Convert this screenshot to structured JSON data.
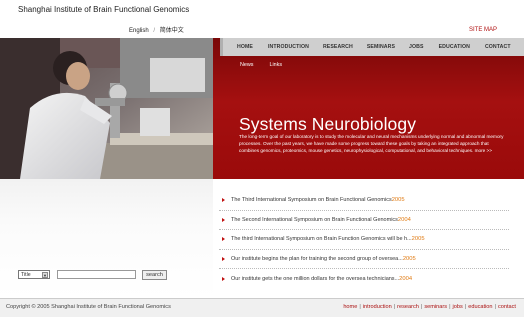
{
  "header": {
    "site_title": "Shanghai Institute of Brain Functional Genomics",
    "lang_en": "English",
    "lang_separator": "/",
    "lang_cn": "简体中文",
    "sitemap": "SITE MAP"
  },
  "topnav": [
    "HOME",
    "INTRODUCTION",
    "RESEARCH",
    "SEMINARS",
    "JOBS",
    "EDUCATION",
    "CONTACT"
  ],
  "subnav": [
    "News",
    "Links"
  ],
  "hero": {
    "headline": "Systems Neurobiology",
    "intro": "The long-term goal of our laboratory is to study the molecular and neural mechanisms underlying normal and abnormal memory processes. Over the past years, we have made some progress toward these goals by taking an integrated approach that combines genomics, proteomics, mouse genetics, neurophysiological, computational, and behavioral techniques.",
    "more": "more >>"
  },
  "search": {
    "select_value": "Title",
    "select_arrow": "▼",
    "input_value": "",
    "button_label": "search"
  },
  "news": [
    {
      "title": "The Third International Symposium on Brain Functional Genomics",
      "year": "2005"
    },
    {
      "title": "The Second International Symposium on Brain Functional Genomics",
      "year": "2004"
    },
    {
      "title": "The third International Symposium on Brain Function Genomics will be h...",
      "year": "2005"
    },
    {
      "title": "Our institute begins the plan for training the second group of oversea...",
      "year": "2005"
    },
    {
      "title": "Our institute gets the one million dollars for the oversea technicians...",
      "year": "2004"
    }
  ],
  "footer": {
    "copyright": "Copyright © 2005 Shanghai Institute of Brain Functional Genomics",
    "links": [
      "home",
      "introduction",
      "research",
      "seminars",
      "jobs",
      "education",
      "contact"
    ],
    "separator": "|"
  },
  "colors": {
    "brand_red": "#9a0a0a",
    "accent_orange": "#e07a12",
    "nav_gray": "#cfcfcf"
  }
}
